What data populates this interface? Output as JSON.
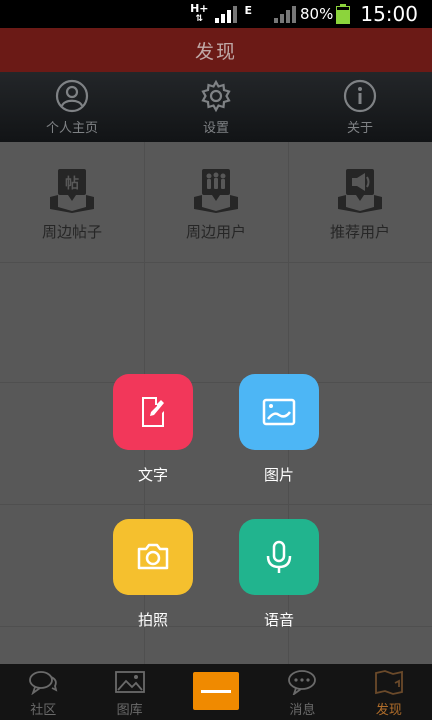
{
  "status_bar": {
    "network_label": "H+",
    "data_label": "E",
    "battery_percent": "80%",
    "time": "15:00"
  },
  "header": {
    "title": "发现"
  },
  "top_nav": [
    {
      "label": "个人主页",
      "icon": "user-icon"
    },
    {
      "label": "设置",
      "icon": "gear-icon"
    },
    {
      "label": "关于",
      "icon": "info-icon"
    }
  ],
  "features": [
    {
      "label": "周边帖子",
      "icon": "nearby-posts-icon"
    },
    {
      "label": "周边用户",
      "icon": "nearby-users-icon"
    },
    {
      "label": "推荐用户",
      "icon": "recommended-users-icon"
    }
  ],
  "post_options": [
    {
      "label": "文字",
      "icon": "edit-icon",
      "color": "#f2375a"
    },
    {
      "label": "图片",
      "icon": "image-icon",
      "color": "#4db6f5"
    },
    {
      "label": "拍照",
      "icon": "camera-icon",
      "color": "#f5c02e"
    },
    {
      "label": "语音",
      "icon": "microphone-icon",
      "color": "#21b48e"
    }
  ],
  "bottom_tabs": [
    {
      "label": "社区",
      "icon": "chat-icon"
    },
    {
      "label": "图库",
      "icon": "gallery-icon"
    },
    {
      "label": "",
      "icon": "minus-icon",
      "color": "#f08a00"
    },
    {
      "label": "消息",
      "icon": "message-icon"
    },
    {
      "label": "发现",
      "icon": "discover-icon",
      "active": true
    }
  ],
  "colors": {
    "title_bar": "#6b1a16",
    "overlay": "#585858",
    "active_tab": "#b06d2a"
  }
}
